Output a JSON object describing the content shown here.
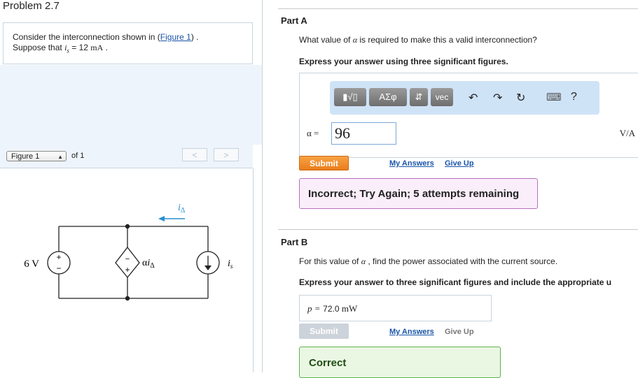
{
  "problem": {
    "title": "Problem 2.7",
    "line1_prefix": "Consider the interconnection shown in (",
    "figure_link": "Figure 1",
    "line1_suffix": ") .",
    "line2_prefix": "Suppose that ",
    "is_symbol": "i",
    "is_sub": "s",
    "line2_eq": " = 12 ",
    "line2_unit": "mA",
    "line2_end": " ."
  },
  "figure_nav": {
    "select_value": "Figure 1",
    "of_text": "of 1",
    "prev": "<",
    "next": ">"
  },
  "circuit": {
    "source_label": "6 V",
    "plus": "+",
    "minus": "−",
    "dep_label_alpha": "α",
    "dep_label_i": "i",
    "dep_label_sub": "Δ",
    "current_label": "i",
    "current_sub": "Δ",
    "is_label": "i",
    "is_sub": "s"
  },
  "partA": {
    "title": "Part A",
    "question_prefix": "What value of ",
    "alpha": "α",
    "question_suffix": " is required to make this a valid interconnection?",
    "instruction": "Express your answer using three significant figures.",
    "toolbar": {
      "templates": "▮√▯",
      "greek": "ΑΣφ",
      "arrows": "⇵",
      "vec": "vec",
      "undo": "↶",
      "redo": "↷",
      "reset": "↻",
      "keyboard": "⌨",
      "help": "?"
    },
    "input_label": "α =",
    "input_value": "96",
    "unit": "V/A",
    "submit": "Submit",
    "my_answers": "My Answers",
    "give_up": "Give Up",
    "feedback": "Incorrect; Try Again; 5 attempts remaining"
  },
  "partB": {
    "title": "Part B",
    "question_prefix": "For this value of ",
    "alpha": "α",
    "question_suffix": " , find the power associated with the current source.",
    "instruction": "Express your answer to three significant figures and include the appropriate u",
    "answer_label": "p =",
    "answer_value": "72.0 ",
    "answer_unit": "mW",
    "submit": "Submit",
    "my_answers": "My Answers",
    "give_up": "Give Up",
    "feedback": "Correct"
  }
}
